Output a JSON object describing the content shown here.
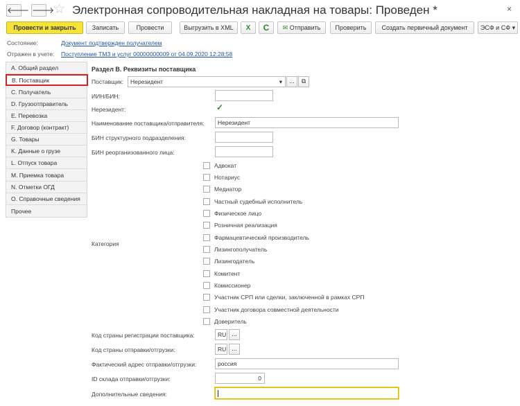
{
  "window": {
    "title": "Электронная сопроводительная накладная на товары: Проведен *",
    "back_glyph": "🡐",
    "forward_glyph": "🡒",
    "star_glyph": "☆",
    "close_glyph": "×"
  },
  "toolbar": {
    "post_and_close": "Провести и закрыть",
    "save": "Записать",
    "post": "Провести",
    "export_xml": "Выгрузить в XML",
    "xml_icon_glyph": "X",
    "refresh_icon_glyph": "C",
    "send": "Отправить",
    "send_icon_glyph": "✉",
    "check": "Проверить",
    "create_primary": "Создать первичный документ",
    "esf": "ЭСФ и СФ",
    "esf_arrow": "▾"
  },
  "status": {
    "state_label": "Состояние:",
    "state_value": "Документ подтвержден получателем",
    "reflected_label": "Отражен в учете:",
    "reflected_value": "Поступление ТМЗ и услуг 00000000009 от 04.09.2020 12:28:58"
  },
  "nav": {
    "items": [
      {
        "label": "A. Общий раздел"
      },
      {
        "label": "B. Поставщик"
      },
      {
        "label": "C. Получатель"
      },
      {
        "label": "D. Грузоотправитель"
      },
      {
        "label": "E. Перевозка"
      },
      {
        "label": "F. Договор (контракт)"
      },
      {
        "label": "G. Товары"
      },
      {
        "label": "K. Данные о грузе"
      },
      {
        "label": "L. Отпуск товара"
      },
      {
        "label": "M. Приемка товара"
      },
      {
        "label": "N. Отметки ОГД"
      },
      {
        "label": "O. Справочные сведения"
      },
      {
        "label": "Прочее"
      }
    ],
    "active_index": 1
  },
  "form": {
    "section_title": "Раздел B. Реквизиты поставщика",
    "supplier_label": "Поставщик:",
    "supplier_value": "Нерезидент",
    "supplier_dropdown_glyph": "▾",
    "ellipsis": "...",
    "open_glyph": "⧉",
    "iin_label": "ИИН/БИН:",
    "iin_value": "",
    "nonresident_label": "Нерезидент:",
    "nonresident_checked": true,
    "check_glyph": "✓",
    "name_label": "Наименование поставщика/отправителя:",
    "name_value": "Нерезидент",
    "bin_struct_label": "БИН структурного подразделения:",
    "bin_struct_value": "",
    "bin_reorg_label": "БИН реорганизованного лица:",
    "bin_reorg_value": "",
    "category_label": "Категория",
    "categories": [
      {
        "label": "Адвокат",
        "checked": false
      },
      {
        "label": "Нотариус",
        "checked": false
      },
      {
        "label": "Медиатор",
        "checked": false
      },
      {
        "label": "Частный судебный исполнитель",
        "checked": false
      },
      {
        "label": "Физическое лицо",
        "checked": false
      },
      {
        "label": "Розничная реализация",
        "checked": false
      },
      {
        "label": "Фармацевтический производитель",
        "checked": false
      },
      {
        "label": "Лизингополучатель",
        "checked": false
      },
      {
        "label": "Лизингодатель",
        "checked": false
      },
      {
        "label": "Комитент",
        "checked": false
      },
      {
        "label": "Комиссионер",
        "checked": false
      },
      {
        "label": "Участник СРП или сделки, заключенной в рамках СРП",
        "checked": false
      },
      {
        "label": "Участник договора совместной деятельности",
        "checked": false
      },
      {
        "label": "Доверитель",
        "checked": false
      }
    ],
    "reg_country_label": "Код страны регистрации поставщика:",
    "reg_country_value": "RU",
    "ship_country_label": "Код страны отправки/отгрузки:",
    "ship_country_value": "RU",
    "address_label": "Фактический адрес отправки/отгрузки:",
    "address_value": "россия",
    "warehouse_label": "ID склада отправки/отгрузки:",
    "warehouse_value": "0",
    "extra_label": "Дополнительные сведения:",
    "extra_value": ""
  }
}
